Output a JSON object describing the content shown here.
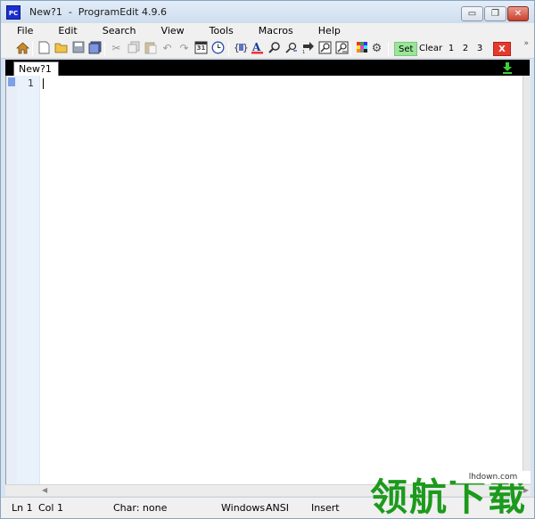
{
  "window": {
    "app_icon_text": "PC",
    "title": "New?1  -  ProgramEdit 4.9.6",
    "controls": {
      "minimize": "▭",
      "restore": "❐",
      "close": "✕"
    }
  },
  "menu": [
    "File",
    "Edit",
    "Search",
    "View",
    "Tools",
    "Macros",
    "Help"
  ],
  "toolbar": {
    "buttons": {
      "set": "Set",
      "clear": "Clear",
      "one": "1",
      "two": "2",
      "three": "3",
      "close": "X"
    },
    "calendar_glyph": "31",
    "more_glyph": "»"
  },
  "tabs": [
    {
      "label": "New?1"
    }
  ],
  "editor": {
    "line_numbers": [
      "1"
    ]
  },
  "status": {
    "line": "Ln 1",
    "col": "Col 1",
    "char": "Char: none",
    "eol": "Windows",
    "encoding": "ANSI",
    "mode": "Insert"
  },
  "watermark": {
    "site": "lhdown.com",
    "text": "领航下载"
  },
  "colors": {
    "set_button": "#9be59b",
    "close_button": "#e43a2e",
    "download_icon": "#3ad23a",
    "watermark": "#1c9a1c"
  }
}
